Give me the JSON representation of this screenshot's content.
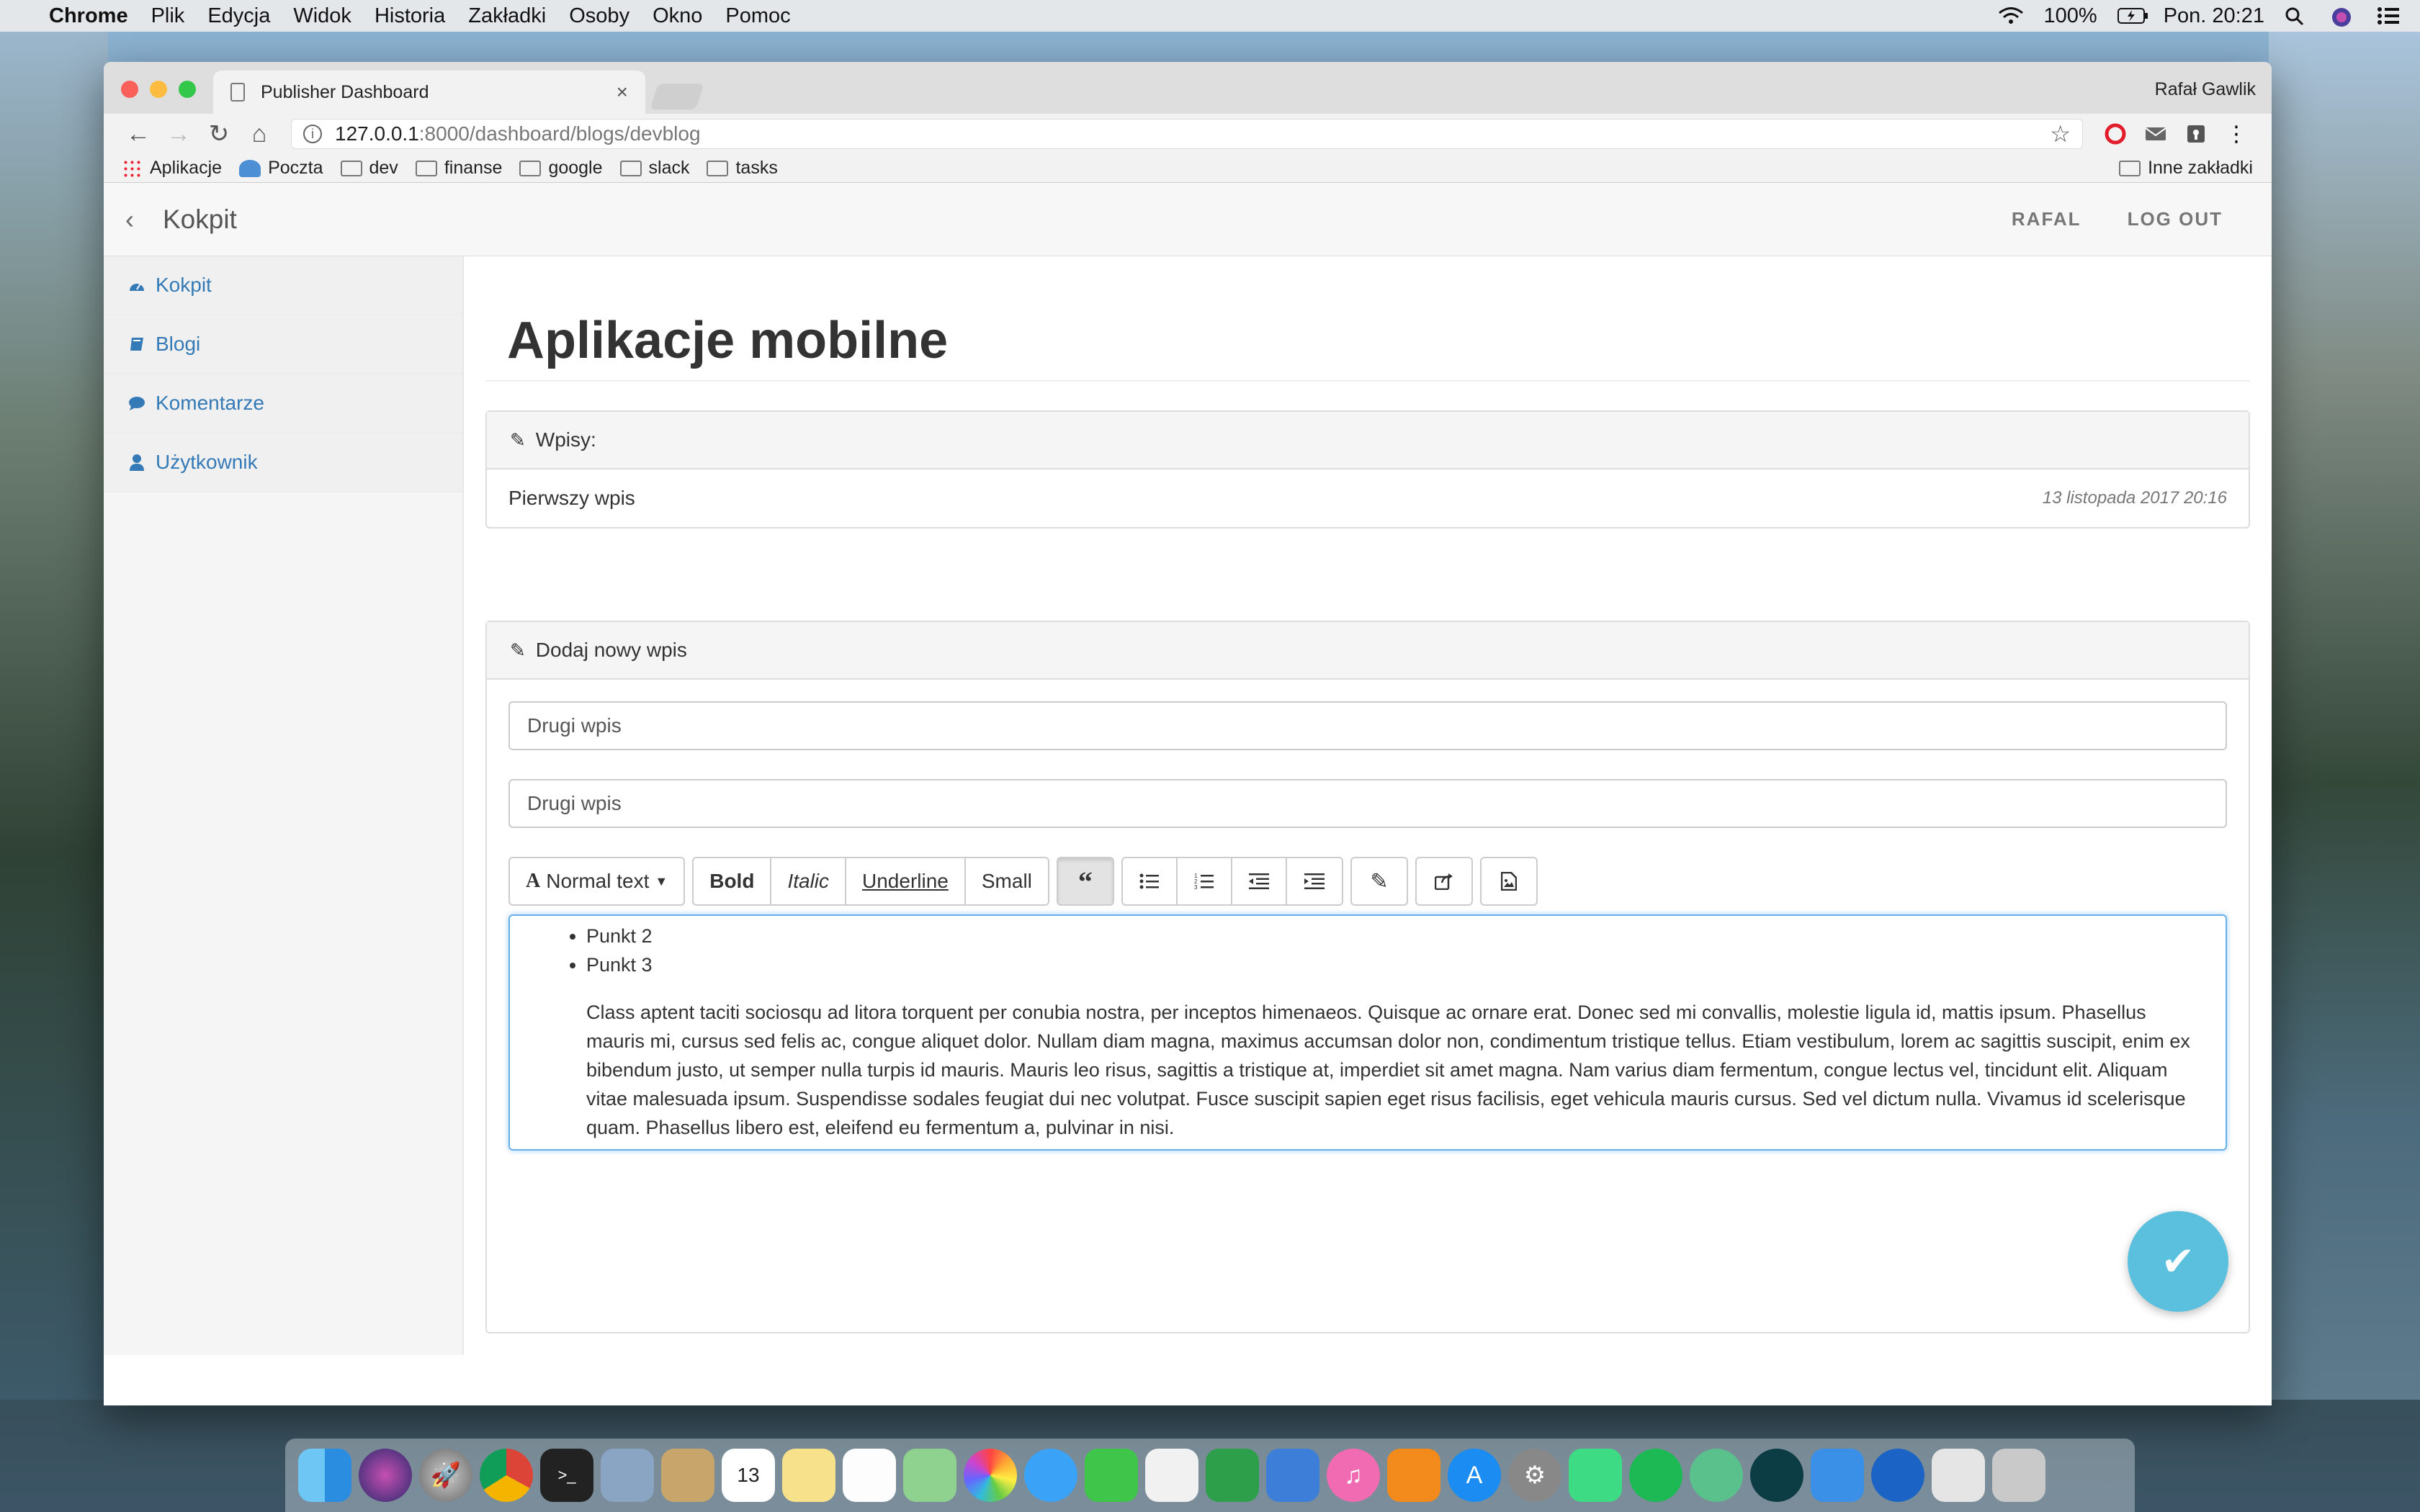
{
  "menubar": {
    "app": "Chrome",
    "items": [
      "Plik",
      "Edycja",
      "Widok",
      "Historia",
      "Zakładki",
      "Osoby",
      "Okno",
      "Pomoc"
    ],
    "battery": "100%",
    "clock": "Pon. 20:21"
  },
  "browser": {
    "tab_title": "Publisher Dashboard",
    "profile": "Rafał Gawlik",
    "url_host": "127.0.0.1",
    "url_path": ":8000/dashboard/blogs/devblog",
    "bookmarks": [
      "Aplikacje",
      "Poczta",
      "dev",
      "finanse",
      "google",
      "slack",
      "tasks"
    ],
    "other_bookmarks": "Inne zakładki"
  },
  "app": {
    "brand": "Kokpit",
    "nav_user": "RAFAL",
    "nav_logout": "LOG OUT",
    "sidebar": [
      {
        "label": "Kokpit",
        "icon": "dashboard-icon"
      },
      {
        "label": "Blogi",
        "icon": "book-icon"
      },
      {
        "label": "Komentarze",
        "icon": "comment-icon"
      },
      {
        "label": "Użytkownik",
        "icon": "user-icon"
      }
    ],
    "page_title": "Aplikacje mobilne",
    "posts_heading": "Wpisy:",
    "posts": [
      {
        "title": "Pierwszy wpis",
        "date": "13 listopada 2017 20:16"
      }
    ],
    "new_post_heading": "Dodaj nowy wpis",
    "title_input": "Drugi wpis",
    "slug_input": "Drugi wpis",
    "toolbar": {
      "text_style": "Normal text",
      "bold": "Bold",
      "italic": "Italic",
      "underline": "Underline",
      "small": "Small"
    },
    "editor": {
      "list_items": [
        "Punkt 2",
        "Punkt 3"
      ],
      "paragraph": "Class aptent taciti sociosqu ad litora torquent per conubia nostra, per inceptos himenaeos. Quisque ac ornare erat. Donec sed mi convallis, molestie ligula id, mattis ipsum. Phasellus mauris mi, cursus sed felis ac, congue aliquet dolor. Nullam diam magna, maximus accumsan dolor non, condimentum tristique tellus. Etiam vestibulum, lorem ac sagittis suscipit, enim ex bibendum justo, ut semper nulla turpis id mauris. Mauris leo risus, sagittis a tristique at, imperdiet sit amet magna. Nam varius diam fermentum, congue lectus vel, tincidunt elit. Aliquam vitae malesuada ipsum. Suspendisse sodales feugiat dui nec volutpat. Fusce suscipit sapien eget risus facilisis, eget vehicula mauris cursus. Sed vel dictum nulla. Vivamus id scelerisque quam. Phasellus libero est, eleifend eu fermentum a, pulvinar in nisi."
    },
    "accent_color": "#337ab7",
    "fab_color": "#5bc0de"
  },
  "dock": [
    "finder",
    "siri",
    "launchpad",
    "chrome",
    "terminal",
    "preview",
    "notes",
    "calendar",
    "stickies",
    "reminders",
    "maps",
    "photos",
    "messages",
    "facetime",
    "textedit",
    "numbers",
    "keynote",
    "itunes",
    "ibooks",
    "app-store",
    "system-preferences",
    "android-studio",
    "spotify",
    "atom",
    "gitkraken",
    "xcode",
    "sourcetree",
    "files",
    "trash"
  ]
}
